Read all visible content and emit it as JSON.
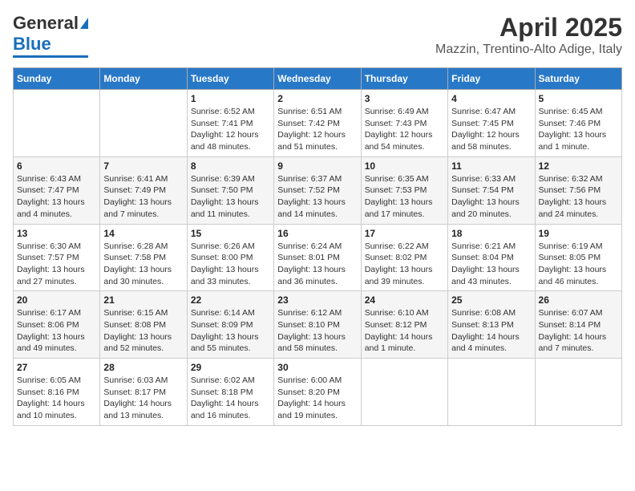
{
  "header": {
    "logo_general": "General",
    "logo_blue": "Blue",
    "title": "April 2025",
    "subtitle": "Mazzin, Trentino-Alto Adige, Italy"
  },
  "calendar": {
    "days_of_week": [
      "Sunday",
      "Monday",
      "Tuesday",
      "Wednesday",
      "Thursday",
      "Friday",
      "Saturday"
    ],
    "weeks": [
      [
        {
          "day": "",
          "info": ""
        },
        {
          "day": "",
          "info": ""
        },
        {
          "day": "1",
          "info": "Sunrise: 6:52 AM\nSunset: 7:41 PM\nDaylight: 12 hours and 48 minutes."
        },
        {
          "day": "2",
          "info": "Sunrise: 6:51 AM\nSunset: 7:42 PM\nDaylight: 12 hours and 51 minutes."
        },
        {
          "day": "3",
          "info": "Sunrise: 6:49 AM\nSunset: 7:43 PM\nDaylight: 12 hours and 54 minutes."
        },
        {
          "day": "4",
          "info": "Sunrise: 6:47 AM\nSunset: 7:45 PM\nDaylight: 12 hours and 58 minutes."
        },
        {
          "day": "5",
          "info": "Sunrise: 6:45 AM\nSunset: 7:46 PM\nDaylight: 13 hours and 1 minute."
        }
      ],
      [
        {
          "day": "6",
          "info": "Sunrise: 6:43 AM\nSunset: 7:47 PM\nDaylight: 13 hours and 4 minutes."
        },
        {
          "day": "7",
          "info": "Sunrise: 6:41 AM\nSunset: 7:49 PM\nDaylight: 13 hours and 7 minutes."
        },
        {
          "day": "8",
          "info": "Sunrise: 6:39 AM\nSunset: 7:50 PM\nDaylight: 13 hours and 11 minutes."
        },
        {
          "day": "9",
          "info": "Sunrise: 6:37 AM\nSunset: 7:52 PM\nDaylight: 13 hours and 14 minutes."
        },
        {
          "day": "10",
          "info": "Sunrise: 6:35 AM\nSunset: 7:53 PM\nDaylight: 13 hours and 17 minutes."
        },
        {
          "day": "11",
          "info": "Sunrise: 6:33 AM\nSunset: 7:54 PM\nDaylight: 13 hours and 20 minutes."
        },
        {
          "day": "12",
          "info": "Sunrise: 6:32 AM\nSunset: 7:56 PM\nDaylight: 13 hours and 24 minutes."
        }
      ],
      [
        {
          "day": "13",
          "info": "Sunrise: 6:30 AM\nSunset: 7:57 PM\nDaylight: 13 hours and 27 minutes."
        },
        {
          "day": "14",
          "info": "Sunrise: 6:28 AM\nSunset: 7:58 PM\nDaylight: 13 hours and 30 minutes."
        },
        {
          "day": "15",
          "info": "Sunrise: 6:26 AM\nSunset: 8:00 PM\nDaylight: 13 hours and 33 minutes."
        },
        {
          "day": "16",
          "info": "Sunrise: 6:24 AM\nSunset: 8:01 PM\nDaylight: 13 hours and 36 minutes."
        },
        {
          "day": "17",
          "info": "Sunrise: 6:22 AM\nSunset: 8:02 PM\nDaylight: 13 hours and 39 minutes."
        },
        {
          "day": "18",
          "info": "Sunrise: 6:21 AM\nSunset: 8:04 PM\nDaylight: 13 hours and 43 minutes."
        },
        {
          "day": "19",
          "info": "Sunrise: 6:19 AM\nSunset: 8:05 PM\nDaylight: 13 hours and 46 minutes."
        }
      ],
      [
        {
          "day": "20",
          "info": "Sunrise: 6:17 AM\nSunset: 8:06 PM\nDaylight: 13 hours and 49 minutes."
        },
        {
          "day": "21",
          "info": "Sunrise: 6:15 AM\nSunset: 8:08 PM\nDaylight: 13 hours and 52 minutes."
        },
        {
          "day": "22",
          "info": "Sunrise: 6:14 AM\nSunset: 8:09 PM\nDaylight: 13 hours and 55 minutes."
        },
        {
          "day": "23",
          "info": "Sunrise: 6:12 AM\nSunset: 8:10 PM\nDaylight: 13 hours and 58 minutes."
        },
        {
          "day": "24",
          "info": "Sunrise: 6:10 AM\nSunset: 8:12 PM\nDaylight: 14 hours and 1 minute."
        },
        {
          "day": "25",
          "info": "Sunrise: 6:08 AM\nSunset: 8:13 PM\nDaylight: 14 hours and 4 minutes."
        },
        {
          "day": "26",
          "info": "Sunrise: 6:07 AM\nSunset: 8:14 PM\nDaylight: 14 hours and 7 minutes."
        }
      ],
      [
        {
          "day": "27",
          "info": "Sunrise: 6:05 AM\nSunset: 8:16 PM\nDaylight: 14 hours and 10 minutes."
        },
        {
          "day": "28",
          "info": "Sunrise: 6:03 AM\nSunset: 8:17 PM\nDaylight: 14 hours and 13 minutes."
        },
        {
          "day": "29",
          "info": "Sunrise: 6:02 AM\nSunset: 8:18 PM\nDaylight: 14 hours and 16 minutes."
        },
        {
          "day": "30",
          "info": "Sunrise: 6:00 AM\nSunset: 8:20 PM\nDaylight: 14 hours and 19 minutes."
        },
        {
          "day": "",
          "info": ""
        },
        {
          "day": "",
          "info": ""
        },
        {
          "day": "",
          "info": ""
        }
      ]
    ]
  }
}
